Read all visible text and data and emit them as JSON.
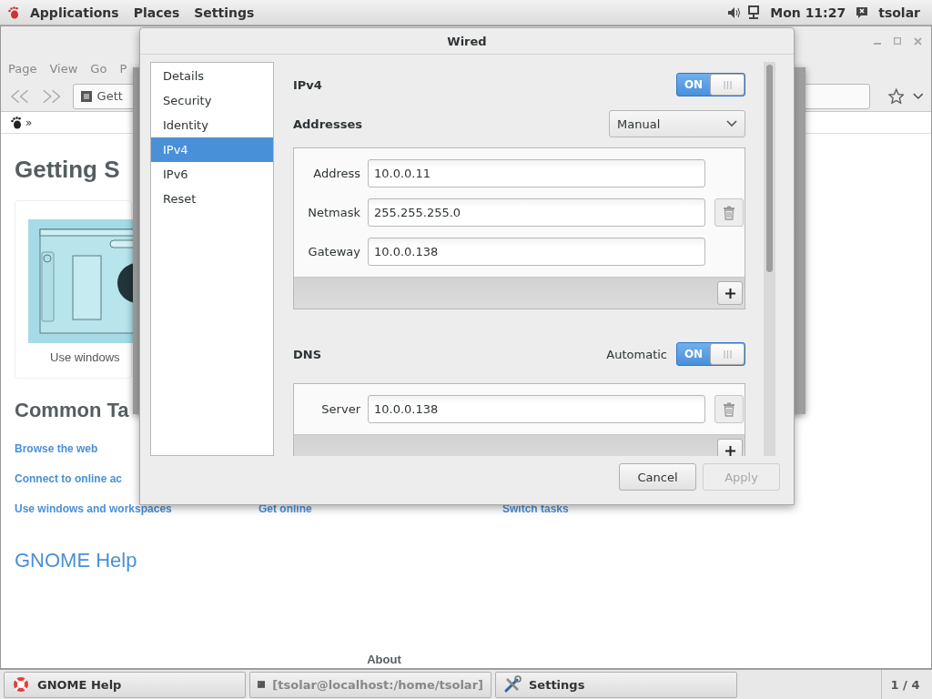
{
  "top_bar": {
    "menus": [
      {
        "label": "Applications"
      },
      {
        "label": "Places"
      },
      {
        "label": "Settings"
      }
    ],
    "clock": "Mon 11:27",
    "user": "tsolar"
  },
  "help_window": {
    "menus": [
      {
        "label": "Page"
      },
      {
        "label": "View"
      },
      {
        "label": "Go"
      },
      {
        "label": "P"
      }
    ],
    "address": "Gett",
    "breadcrumb": "»",
    "heading": "Getting S",
    "card_caption": "Use windows",
    "section_heading": "Common Ta",
    "link_rows": [
      {
        "links": [
          {
            "label": "Browse the web"
          }
        ]
      },
      {
        "links": [
          {
            "label": "Connect to online ac"
          }
        ]
      },
      {
        "links": [
          {
            "label": "Use windows and workspaces"
          },
          {
            "label": "Get online"
          },
          {
            "label": "Switch tasks"
          }
        ]
      }
    ],
    "title_link": "GNOME Help",
    "footer": "About"
  },
  "dialog": {
    "title": "Wired",
    "pages": [
      {
        "label": "Details",
        "selected": false
      },
      {
        "label": "Security",
        "selected": false
      },
      {
        "label": "Identity",
        "selected": false
      },
      {
        "label": "IPv4",
        "selected": true
      },
      {
        "label": "IPv6",
        "selected": false
      },
      {
        "label": "Reset",
        "selected": false
      }
    ],
    "ipv4": {
      "label": "IPv4",
      "switch": {
        "label": "ON",
        "on": true
      }
    },
    "addresses": {
      "label": "Addresses",
      "method": "Manual",
      "fields": [
        {
          "label": "Address",
          "value": "10.0.0.11",
          "removable": false
        },
        {
          "label": "Netmask",
          "value": "255.255.255.0",
          "removable": true
        },
        {
          "label": "Gateway",
          "value": "10.0.0.138",
          "removable": false
        }
      ]
    },
    "dns": {
      "label": "DNS",
      "switch_label": "Automatic",
      "switch": {
        "label": "ON",
        "on": true
      },
      "fields": [
        {
          "label": "Server",
          "value": "10.0.0.138",
          "removable": true
        }
      ]
    },
    "buttons": [
      {
        "label": "Cancel",
        "disabled": false
      },
      {
        "label": "Apply",
        "disabled": true
      }
    ]
  },
  "taskbar": {
    "tasks": [
      {
        "label": "GNOME Help",
        "kind": "help",
        "minimized": false
      },
      {
        "label": "[tsolar@localhost:/home/tsolar]",
        "kind": "terminal",
        "minimized": true
      },
      {
        "label": "Settings",
        "kind": "settings",
        "minimized": false
      }
    ],
    "workspace": "1 / 4"
  }
}
